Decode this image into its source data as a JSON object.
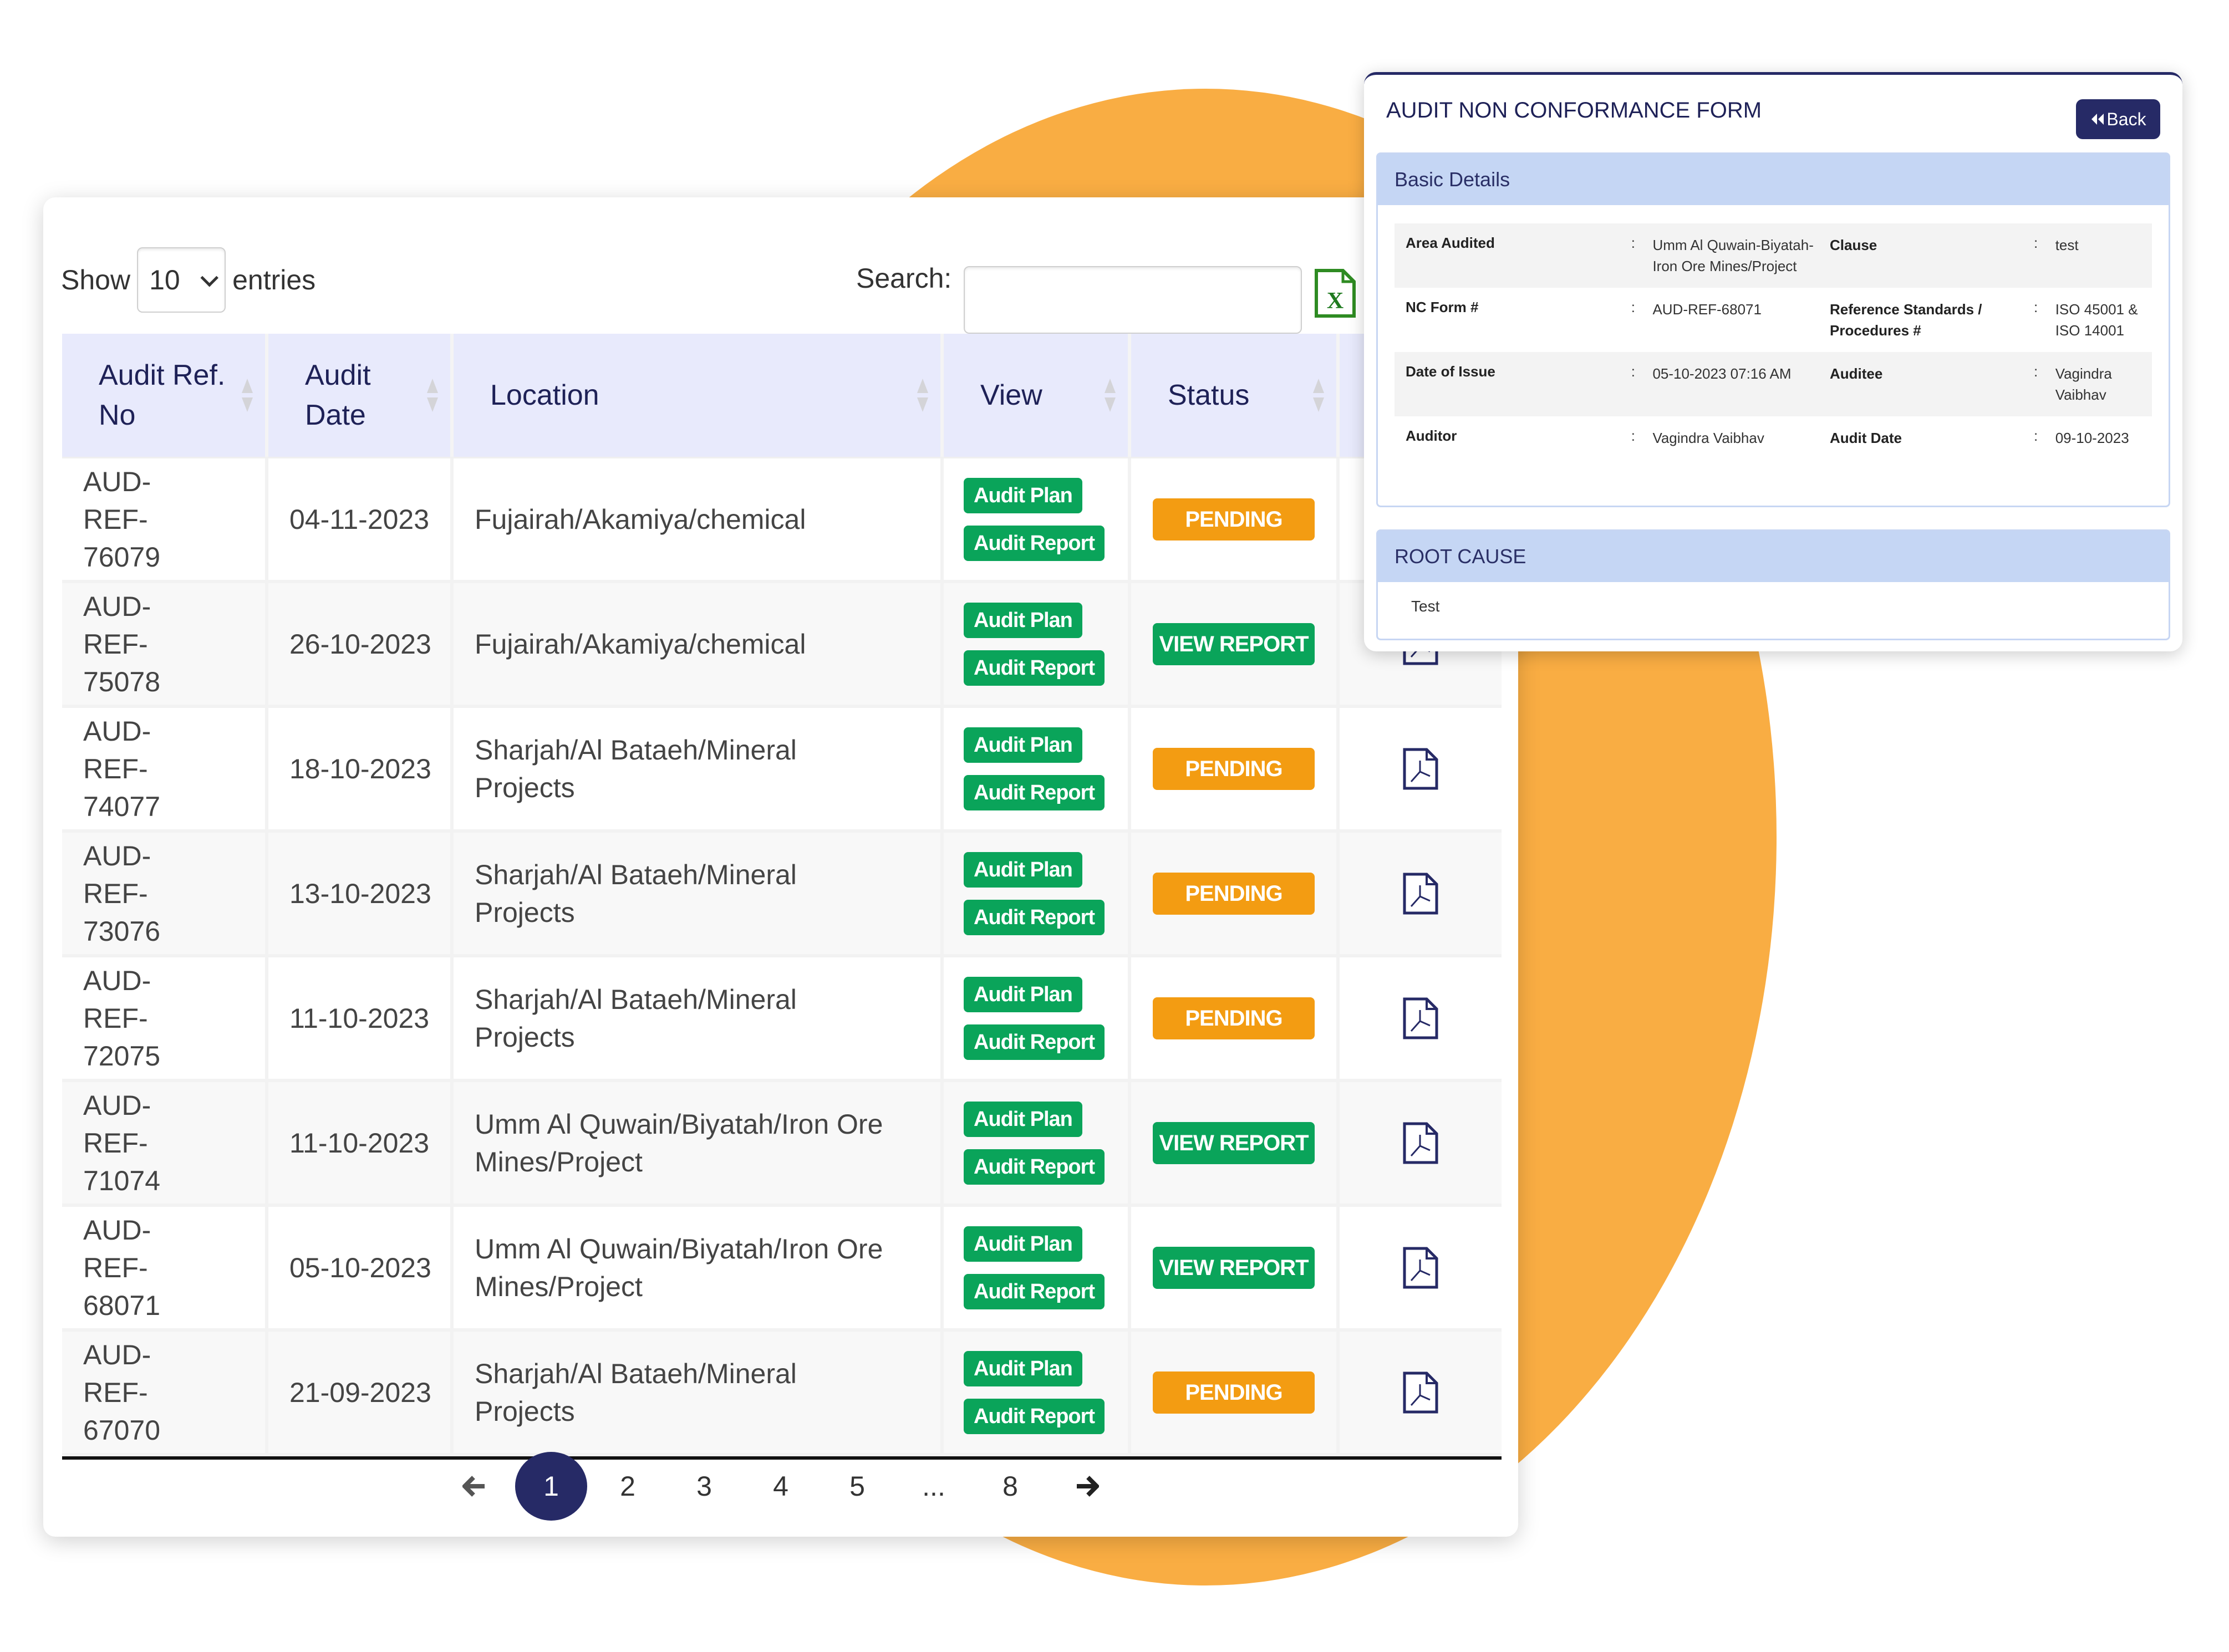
{
  "controls": {
    "show_label": "Show",
    "entries_value": "10",
    "entries_label": "entries",
    "search_label": "Search:",
    "search_value": "",
    "export_icon": "excel-icon"
  },
  "table": {
    "columns": [
      {
        "label": "Audit Ref. No"
      },
      {
        "label": "Audit Date"
      },
      {
        "label": "Location"
      },
      {
        "label": "View"
      },
      {
        "label": "Status"
      },
      {
        "label": ""
      }
    ],
    "rows": [
      {
        "ref": "AUD-REF-76079",
        "date": "04-11-2023",
        "location": "Fujairah/Akamiya/chemical",
        "plan": "Audit Plan",
        "report": "Audit Report",
        "status": "PENDING",
        "status_type": "pending"
      },
      {
        "ref": "AUD-REF-75078",
        "date": "26-10-2023",
        "location": "Fujairah/Akamiya/chemical",
        "plan": "Audit Plan",
        "report": "Audit Report",
        "status": "VIEW REPORT",
        "status_type": "view"
      },
      {
        "ref": "AUD-REF-74077",
        "date": "18-10-2023",
        "location": "Sharjah/Al Bataeh/Mineral Projects",
        "plan": "Audit Plan",
        "report": "Audit Report",
        "status": "PENDING",
        "status_type": "pending"
      },
      {
        "ref": "AUD-REF-73076",
        "date": "13-10-2023",
        "location": "Sharjah/Al Bataeh/Mineral Projects",
        "plan": "Audit Plan",
        "report": "Audit Report",
        "status": "PENDING",
        "status_type": "pending"
      },
      {
        "ref": "AUD-REF-72075",
        "date": "11-10-2023",
        "location": "Sharjah/Al Bataeh/Mineral Projects",
        "plan": "Audit Plan",
        "report": "Audit Report",
        "status": "PENDING",
        "status_type": "pending"
      },
      {
        "ref": "AUD-REF-71074",
        "date": "11-10-2023",
        "location": "Umm Al Quwain/Biyatah/Iron Ore Mines/Project",
        "plan": "Audit Plan",
        "report": "Audit Report",
        "status": "VIEW REPORT",
        "status_type": "view"
      },
      {
        "ref": "AUD-REF-68071",
        "date": "05-10-2023",
        "location": "Umm Al Quwain/Biyatah/Iron Ore Mines/Project",
        "plan": "Audit Plan",
        "report": "Audit Report",
        "status": "VIEW REPORT",
        "status_type": "view"
      },
      {
        "ref": "AUD-REF-67070",
        "date": "21-09-2023",
        "location": "Sharjah/Al Bataeh/Mineral Projects",
        "plan": "Audit Plan",
        "report": "Audit Report",
        "status": "PENDING",
        "status_type": "pending"
      }
    ]
  },
  "pagination": {
    "pages": [
      "1",
      "2",
      "3",
      "4",
      "5",
      "...",
      "8"
    ],
    "current": "1"
  },
  "panel": {
    "title": "AUDIT NON CONFORMANCE FORM",
    "back_label": "Back",
    "basic_title": "Basic Details",
    "details": [
      {
        "k1": "Area Audited",
        "v1": "Umm Al Quwain-Biyatah-Iron Ore Mines/Project",
        "k2": "Clause",
        "v2": "test"
      },
      {
        "k1": "NC Form #",
        "v1": "AUD-REF-68071",
        "k2": "Reference Standards / Procedures #",
        "v2": "ISO 45001 & ISO 14001"
      },
      {
        "k1": "Date of Issue",
        "v1": "05-10-2023 07:16 AM",
        "k2": "Auditee",
        "v2": "Vagindra Vaibhav"
      },
      {
        "k1": "Auditor",
        "v1": "Vagindra Vaibhav",
        "k2": "Audit Date",
        "v2": "09-10-2023"
      }
    ],
    "separator": ":",
    "root_title": "ROOT CAUSE",
    "root_text": "Test"
  },
  "colors": {
    "accent_navy": "#262a66",
    "green": "#0aa45a",
    "pending_orange": "#f39c12",
    "background_blob": "#f9ad43",
    "header_lavender": "#e8eafc",
    "section_blue": "#c5d6f4"
  }
}
